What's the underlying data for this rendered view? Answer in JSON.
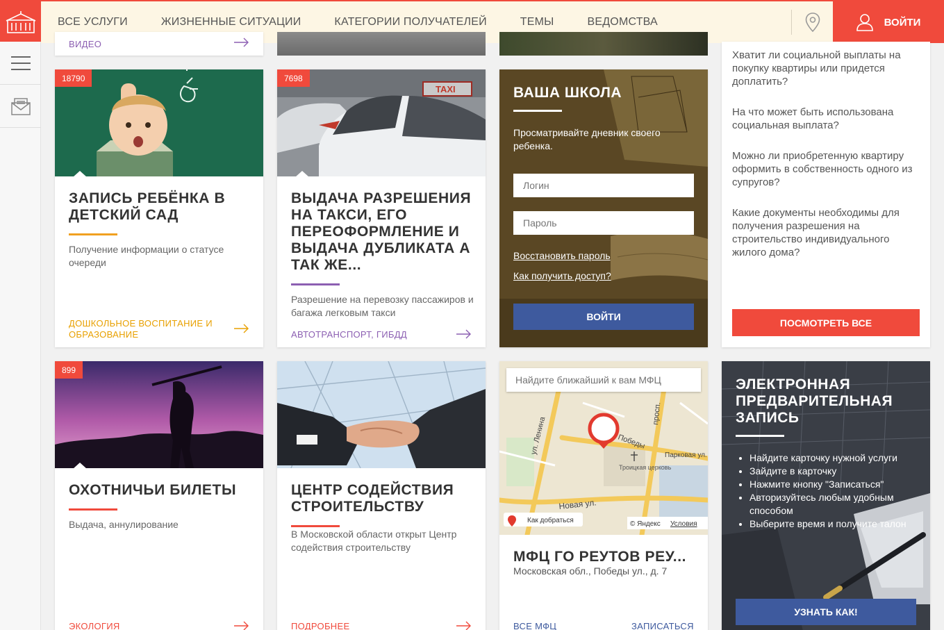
{
  "colors": {
    "accent": "#f04a3c",
    "nav_bg": "#fdf6e4",
    "button_blue": "#3e5a9e",
    "line_orange": "#f0a020",
    "line_purple": "#8c5fb2",
    "line_red": "#f04a3c"
  },
  "nav": {
    "items": [
      "ВСЕ УСЛУГИ",
      "ЖИЗНЕННЫЕ СИТУАЦИИ",
      "КАТЕГОРИИ ПОЛУЧАТЕЛЕЙ",
      "ТЕМЫ",
      "ВЕДОМСТВА"
    ],
    "login_label": "ВОЙТИ",
    "icons": {
      "logo": "government-building-icon",
      "location": "map-pin-icon",
      "user": "user-icon"
    }
  },
  "sidebar": {
    "icons": [
      "hamburger-menu-icon",
      "envelope-icon"
    ]
  },
  "top_partial": {
    "video_link": "ВИДЕО"
  },
  "cards": [
    {
      "badge": "18790",
      "title": "ЗАПИСЬ РЕБЁНКА В ДЕТСКИЙ САД",
      "description": "Получение информации о статусе очереди",
      "link": "ДОШКОЛЬНОЕ ВОСПИТАНИЕ И ОБРАЗОВАНИЕ",
      "accent": "#f0a020"
    },
    {
      "badge": "7698",
      "title": "ВЫДАЧА РАЗРЕШЕНИЯ НА ТАКСИ, ЕГО ПЕРЕОФОРМЛЕНИЕ И ВЫДАЧА ДУБЛИКАТА А ТАК ЖЕ...",
      "description": "Разрешение на перевозку пассажиров и багажа легковым такси",
      "link": "АВТОТРАНСПОРТ, ГИБДД",
      "accent": "#8c5fb2",
      "image_text": "TAXI"
    },
    {
      "badge": "899",
      "title": "ОХОТНИЧЬИ БИЛЕТЫ",
      "description": "Выдача, аннулирование",
      "link": "ЭКОЛОГИЯ",
      "accent": "#f04a3c"
    },
    {
      "title": "ЦЕНТР СОДЕЙСТВИЯ СТРОИТЕЛЬСТВУ",
      "description": "В Московской области открыт Центр содействия строительству",
      "link": "ПОДРОБНЕЕ",
      "accent": "#f04a3c"
    }
  ],
  "school": {
    "title": "ВАША ШКОЛА",
    "description": "Просматривайте дневник своего ребенка.",
    "login_placeholder": "Логин",
    "password_placeholder": "Пароль",
    "restore_link": "Восстановить пароль",
    "access_link": "Как получить доступ?",
    "submit": "ВОЙТИ"
  },
  "faq": {
    "items": [
      "Хватит ли социальной выплаты на покупку квартиры или придется доплатить?",
      "На что может быть использована социальная выплата?",
      "Можно ли приобретенную квартиру оформить в собственность одного из супругов?",
      "Какие документы необходимы для получения разрешения на строительство индивидуального жилого дома?"
    ],
    "button": "ПОСМОТРЕТЬ ВСЕ"
  },
  "mfc": {
    "search_placeholder": "Найдите ближайший к вам МФЦ",
    "title": "МФЦ ГО РЕУТОВ РЕУ...",
    "address": "Московская обл., Победы ул., д. 7",
    "all_link": "ВСЕ МФЦ",
    "signup_link": "ЗАПИСАТЬСЯ",
    "map": {
      "route_label": "Как добраться",
      "copyright": "© Яндекс",
      "terms": "Условия",
      "streets": [
        "ул. Ленина",
        "Новая ул.",
        "Победы",
        "Парковая ул.",
        "просп."
      ],
      "poi": "Троицкая церковь"
    }
  },
  "queue": {
    "title": "ЭЛЕКТРОННАЯ ПРЕДВАРИТЕЛЬНАЯ ЗАПИСЬ",
    "steps": [
      "Найдите карточку нужной услуги",
      "Зайдите в карточку",
      "Нажмите кнопку \"Записаться\"",
      "Авторизуйтесь любым удобным способом",
      "Выберите время и получите талон"
    ],
    "button": "УЗНАТЬ КАК!"
  }
}
